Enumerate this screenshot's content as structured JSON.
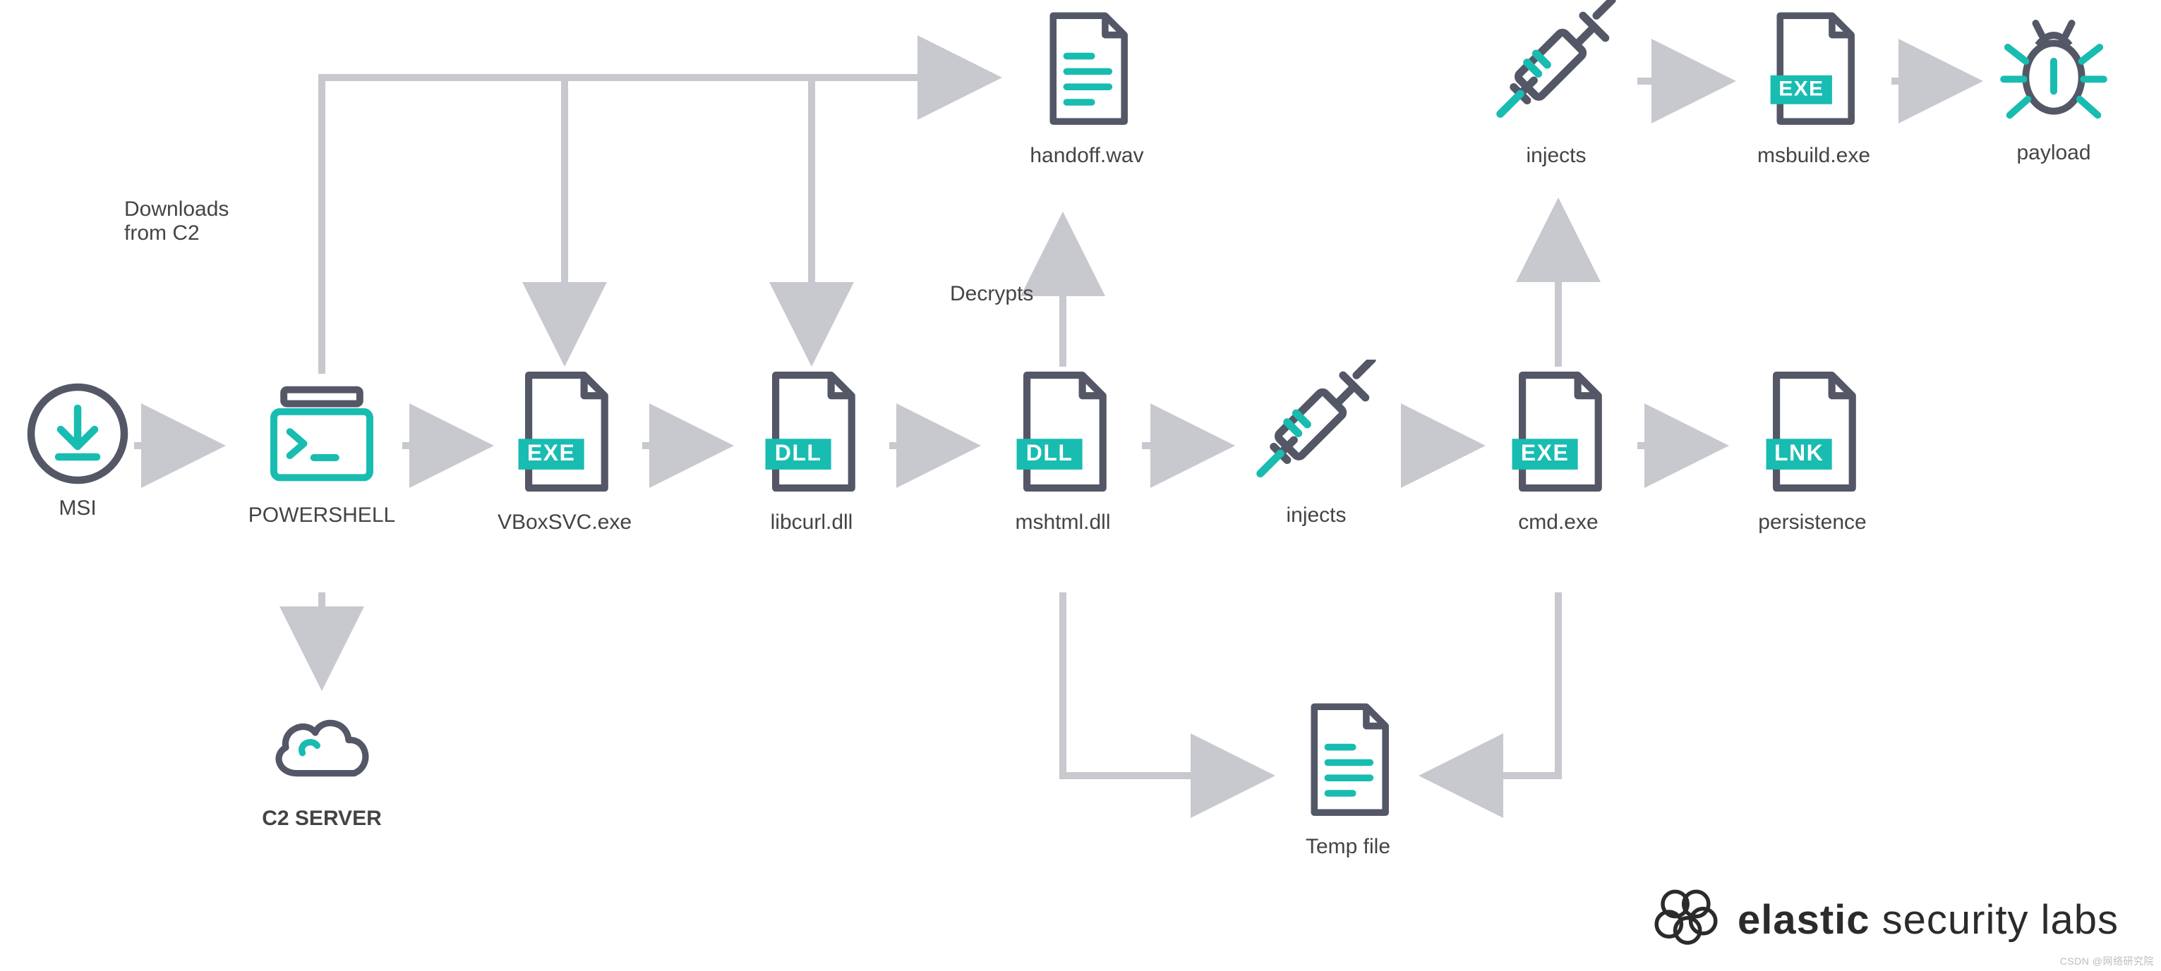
{
  "nodes": {
    "msi": {
      "label": "MSI"
    },
    "powershell": {
      "label": "POWERSHELL"
    },
    "vboxsvc": {
      "label": "VBoxSVC.exe",
      "badge": "EXE"
    },
    "libcurl": {
      "label": "libcurl.dll",
      "badge": "DLL"
    },
    "mshtml": {
      "label": "mshtml.dll",
      "badge": "DLL"
    },
    "injects_mid": {
      "label": "injects"
    },
    "cmd": {
      "label": "cmd.exe",
      "badge": "EXE"
    },
    "persistence": {
      "label": "persistence",
      "badge": "LNK"
    },
    "handoff": {
      "label": "handoff.wav"
    },
    "c2server": {
      "label": "C2 SERVER"
    },
    "tempfile": {
      "label": "Temp file"
    },
    "injects_top": {
      "label": "injects"
    },
    "msbuild": {
      "label": "msbuild.exe",
      "badge": "EXE"
    },
    "payload": {
      "label": "payload"
    }
  },
  "edge_labels": {
    "downloads": "Downloads\nfrom C2",
    "decrypts": "Decrypts"
  },
  "branding": {
    "bold": "elastic",
    "light": "security labs"
  },
  "watermark": "CSDN @网络研究院"
}
